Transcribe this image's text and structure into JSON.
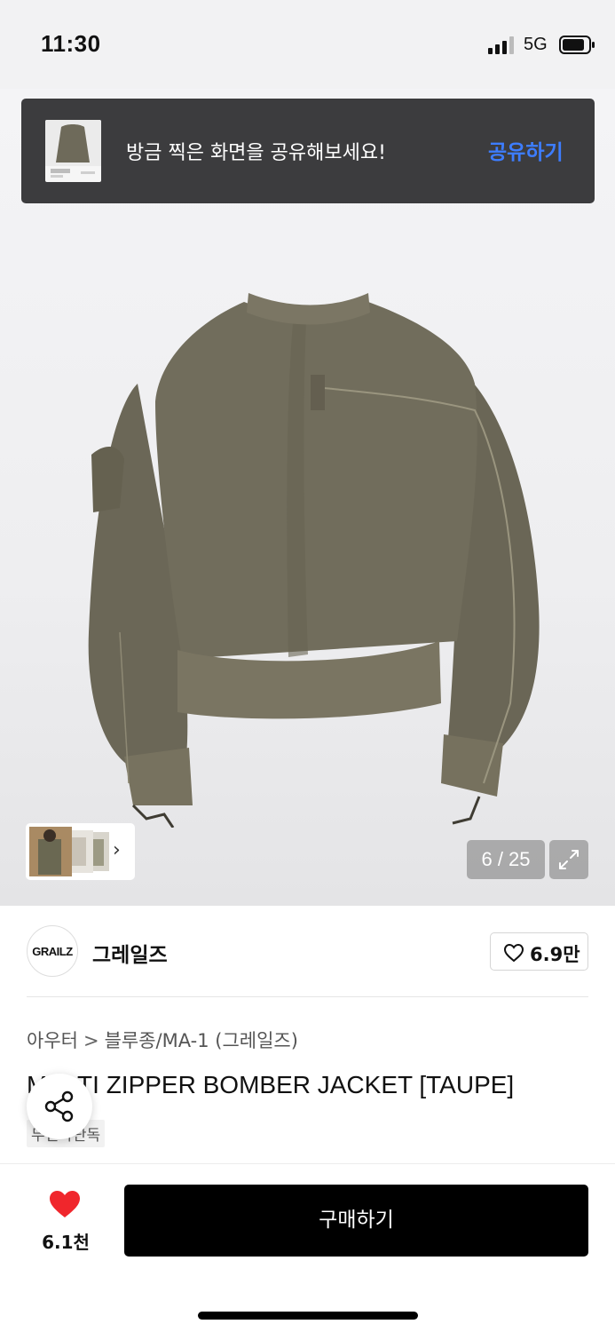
{
  "status_bar": {
    "time": "11:30",
    "network": "5G"
  },
  "share_toast": {
    "message": "방금 찍은 화면을 공유해보세요!",
    "action_label": "공유하기"
  },
  "gallery": {
    "counter": "6 / 25"
  },
  "brand": {
    "logo_text": "GRAILZ",
    "name": "그레일즈",
    "like_count": "6.9만"
  },
  "breadcrumb": {
    "category": "아우터",
    "separator": ">",
    "subcategory": "블루종/MA-1 (그레일즈)"
  },
  "product": {
    "title": "MULTI ZIPPER BOMBER JACKET [TAUPE]",
    "badge": "무신사단독"
  },
  "bottom_bar": {
    "wish_count": "6.1천",
    "buy_label": "구매하기"
  },
  "colors": {
    "accent_blue": "#3d7dff",
    "heart_red": "#f0262c",
    "toast_bg": "#3c3c3e",
    "jacket": "#6e6a5a"
  },
  "icons": [
    "signal-icon",
    "battery-icon",
    "expand-icon",
    "chevron-right-icon",
    "heart-outline-icon",
    "share-icon",
    "heart-filled-icon"
  ]
}
